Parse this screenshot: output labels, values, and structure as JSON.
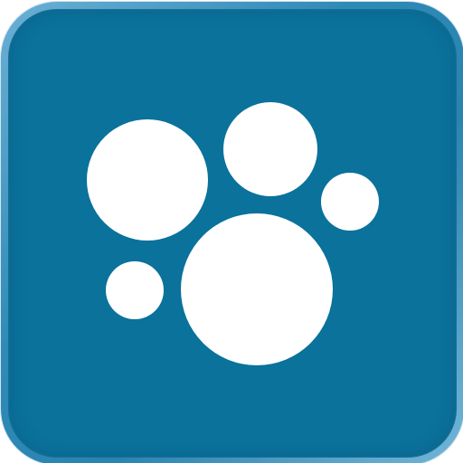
{
  "icon": {
    "name": "paw-logo-icon",
    "background_color": "#0a729b",
    "rim_color": "#4f9fc8",
    "glyph_color": "#ffffff"
  }
}
